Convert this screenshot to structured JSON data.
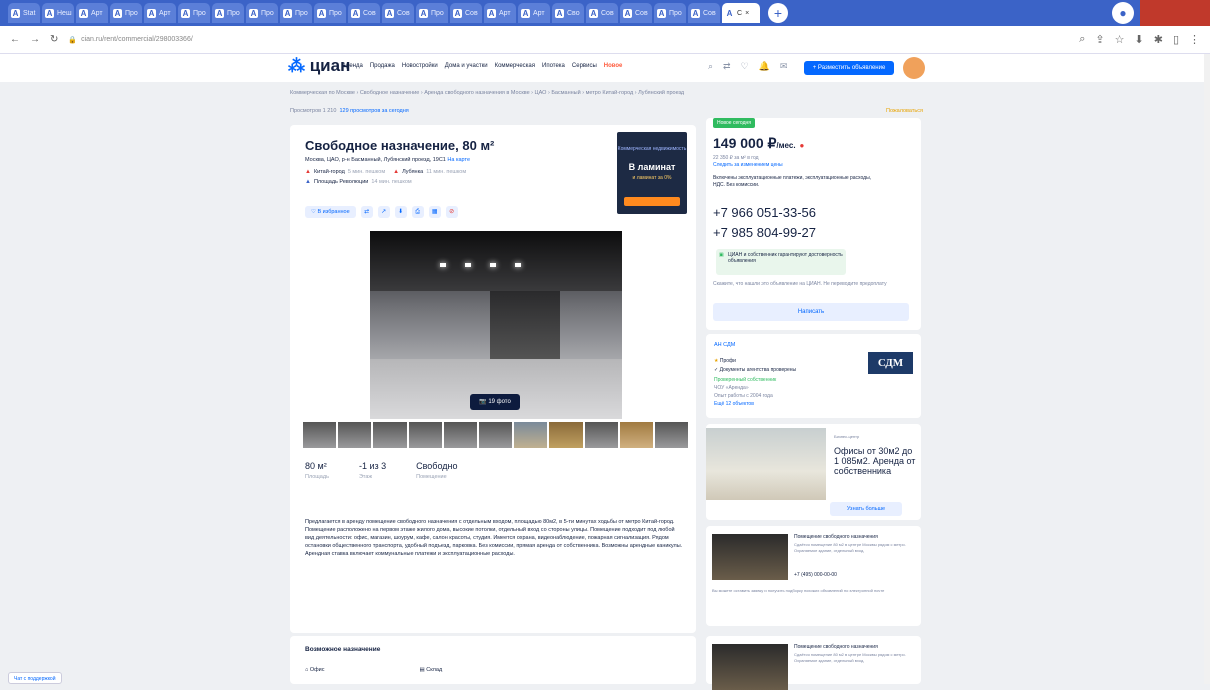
{
  "browser": {
    "tabs": [
      {
        "label": "Stat",
        "icon": "tab-favicon-icon"
      },
      {
        "label": "Неш",
        "icon": "opera-icon"
      },
      {
        "label": "Арт",
        "icon": "cian-icon"
      },
      {
        "label": "Про",
        "icon": "cian-icon"
      },
      {
        "label": "Арт",
        "icon": "cian-icon"
      },
      {
        "label": "Про",
        "icon": "cian-icon"
      },
      {
        "label": "Про",
        "icon": "cian-icon"
      },
      {
        "label": "Про",
        "icon": "cian-icon"
      },
      {
        "label": "Про",
        "icon": "cian-icon"
      },
      {
        "label": "Про",
        "icon": "cian-icon"
      },
      {
        "label": "Сов",
        "icon": "cian-icon"
      },
      {
        "label": "Сов",
        "icon": "cian-icon"
      },
      {
        "label": "Про",
        "icon": "cian-icon"
      },
      {
        "label": "Сов",
        "icon": "cian-icon"
      },
      {
        "label": "Арт",
        "icon": "cian-icon"
      },
      {
        "label": "Арт",
        "icon": "cian-icon"
      },
      {
        "label": "Сво",
        "icon": "cian-icon"
      },
      {
        "label": "Сов",
        "icon": "cian-icon"
      },
      {
        "label": "Сов",
        "icon": "cian-icon"
      },
      {
        "label": "Про",
        "icon": "cian-icon"
      },
      {
        "label": "Сов",
        "icon": "cian-icon"
      }
    ],
    "active_tab": {
      "label": "С",
      "icon": "cian-icon"
    },
    "url": "cian.ru/rent/commercial/298003366/",
    "new_tab": "+"
  },
  "header": {
    "logo_text": "циан",
    "nav": [
      "Аренда",
      "Продажа",
      "Новостройки",
      "Дома и участки",
      "Коммерческая",
      "Ипотека",
      "Сервисы",
      "Новое"
    ],
    "post_button": "+ Разместить объявление"
  },
  "breadcrumbs": "Коммерческая по Москве › Свободное назначение › Аренда свободного назначения в Москве › ЦАО › Басманный › метро Китай-город › Лубянский проезд",
  "views": {
    "count": "Просмотров 1 210",
    "today": "129 просмотров за сегодня"
  },
  "complaint": "Пожаловаться",
  "listing": {
    "title": "Свободное назначение, 80 м²",
    "address": "Москва, ЦАО, р-н Басманный, Лубянский проезд, 19С1",
    "address_link": "На карте",
    "metro": [
      {
        "name": "Китай-город",
        "walk": "5 мин. пешком",
        "color": "#e53935"
      },
      {
        "name": "Лубянка",
        "walk": "11 мин. пешком",
        "color": "#e53935"
      },
      {
        "name": "Площадь Революции",
        "walk": "14 мин. пешком",
        "color": "#3b63c7"
      }
    ],
    "favorite_button": "♡ В избранное",
    "photo_count": "19 фото",
    "specs": [
      {
        "value": "80 м²",
        "label": "Площадь"
      },
      {
        "value": "-1 из 3",
        "label": "Этаж"
      },
      {
        "value": "Свободно",
        "label": "Помещение"
      }
    ],
    "description": "Предлагается в аренду помещение свободного назначения с отдельным входом, площадью 80м2, в 5-ти минутах ходьбы от метро Китай-город. Помещение расположено на первом этаже жилого дома, высокие потолки, отдельный вход со стороны улицы. Помещение подходит под любой вид деятельности: офис, магазин, шоурум, кафе, салон красоты, студия. Имеется охрана, видеонаблюдение, пожарная сигнализация. Рядом остановки общественного транспорта, удобный подъезд, парковка. Без комиссии, прямая аренда от собственника. Возможны арендные каникулы. Арендная ставка включает коммунальные платежи и эксплуатационные расходы.",
    "purposes_title": "Возможное назначение",
    "purposes": [
      "Офис",
      "Склад"
    ]
  },
  "ad": {
    "line1": "Коммерческая недвижимость",
    "line2": "В ламинат",
    "line3": "и ламинат за 0%"
  },
  "sidebar": {
    "new_tag": "Новое сегодня",
    "price": "149 000 ₽",
    "price_unit": "/мес.",
    "price_per_m2": "22 350 ₽ за м² в год",
    "price_link": "Следить за изменением цены",
    "terms": "Включены эксплуатационные платежи, эксплуатационные расходы, НДС. Без комиссии.",
    "phones": [
      "+7 966 051-33-56",
      "+7 985 804-99-27"
    ],
    "ok_text": "ЦИАН и собственник гарантируют достоверность объявления",
    "note": "Скажите, что нашли это объявление на ЦИАН. Не переводите предоплату",
    "write_button": "Написать",
    "agency": {
      "name": "АН СДМ",
      "badge": "Профи",
      "verified": "Документы агентства проверены",
      "line3": "Проверенный собственник",
      "line4": "ЧОУ «Аренда»",
      "line5": "Опыт работы с 2004 года",
      "line6": "Ещё 12 объектов",
      "logo": "СДМ"
    },
    "promo": {
      "header": "Бизнес-центр",
      "text": "Офисы от 30м2 до 1 085м2. Аренда от собственника",
      "button": "Узнать больше"
    },
    "listings": [
      {
        "title": "Помещение свободного назначения",
        "text": "Сдаётся помещение 80 м2 в центре Москвы рядом с метро. Охраняемое здание, отдельный вход.",
        "phone": "+7 (495) 000-00-00",
        "bottom": "Вы можете оставить заявку и получить подборку похожих объявлений по электронной почте"
      },
      {
        "title": "Помещение свободного назначения",
        "text": "Сдаётся помещение 80 м2 в центре Москвы рядом с метро. Охраняемое здание, отдельный вход.",
        "phone": "",
        "bottom": ""
      }
    ]
  },
  "help_button": "Чат с поддержкой"
}
